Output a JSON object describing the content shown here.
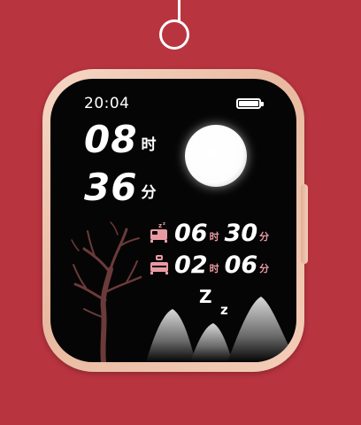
{
  "status": {
    "time": "20:04",
    "battery_level": 1.0
  },
  "clock": {
    "hour": "08",
    "hour_unit": "时",
    "minute": "36",
    "minute_unit": "分"
  },
  "sleep": {
    "bedtime": {
      "icon": "bed-sleep-icon",
      "hours": "06",
      "hours_unit": "时",
      "minutes": "30",
      "minutes_unit": "分"
    },
    "duration": {
      "icon": "alarm-bed-icon",
      "hours": "02",
      "hours_unit": "时",
      "minutes": "06",
      "minutes_unit": "分"
    }
  },
  "decor": {
    "z_large": "Z",
    "z_small": "z"
  },
  "colors": {
    "background": "#b8343f",
    "screen": "#050505",
    "accent_pink": "#e89aa3",
    "case_rose_gold": "#f3cdb8"
  }
}
